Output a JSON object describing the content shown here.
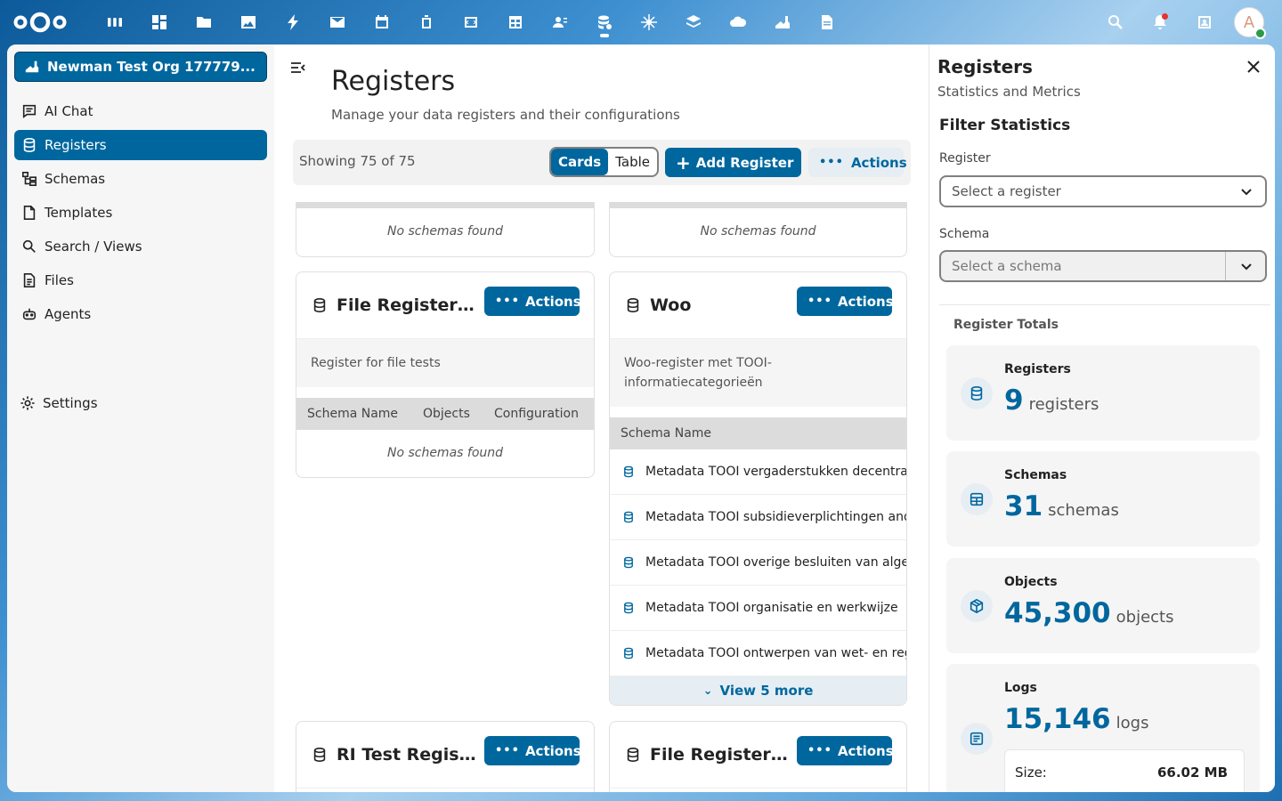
{
  "topbar": {
    "apps": [
      "apps-icon",
      "dashboard-icon",
      "files-icon",
      "photos-icon",
      "activity-icon",
      "mail-icon",
      "calendar-icon",
      "deck-icon",
      "code-icon",
      "spreadsheet-icon",
      "contacts-icon",
      "openregister-icon",
      "spider-icon",
      "layers-icon",
      "cloud-icon",
      "chart-icon",
      "document-icon"
    ],
    "active_app_index": 11,
    "avatar_initial": "A"
  },
  "sidebar": {
    "org_name": "Newman Test Org 177779...",
    "items": [
      {
        "label": "AI Chat",
        "icon": "chat-icon"
      },
      {
        "label": "Registers",
        "icon": "database-icon"
      },
      {
        "label": "Schemas",
        "icon": "schema-icon"
      },
      {
        "label": "Templates",
        "icon": "template-icon"
      },
      {
        "label": "Search / Views",
        "icon": "search-icon"
      },
      {
        "label": "Files",
        "icon": "file-icon"
      },
      {
        "label": "Agents",
        "icon": "robot-icon"
      }
    ],
    "settings_label": "Settings"
  },
  "main": {
    "title": "Registers",
    "subtitle": "Manage your data registers and their configurations",
    "showing": "Showing 75 of 75",
    "view_cards": "Cards",
    "view_table": "Table",
    "add_label": "Add Register",
    "actions_label": "Actions",
    "no_schemas": "No schemas found",
    "cards": [
      {
        "title": "File Register ...",
        "description": "Register for file tests",
        "columns": [
          "Schema Name",
          "Objects",
          "Configuration"
        ],
        "empty": "No schemas found"
      },
      {
        "title": "Woo",
        "description": "Woo-register met TOOI-informatiecategorieën",
        "columns": [
          "Schema Name"
        ],
        "rows": [
          "Metadata TOOI vergaderstukken decentrale",
          "Metadata TOOI subsidieverplichtingen ande",
          "Metadata TOOI overige besluiten van algem",
          "Metadata TOOI organisatie en werkwijze",
          "Metadata TOOI ontwerpen van wet- en rege"
        ],
        "view_more": "View 5 more"
      },
      {
        "title": "RI Test Regist..."
      },
      {
        "title": "File Register ..."
      }
    ]
  },
  "panel": {
    "title": "Registers",
    "subtitle": "Statistics and Metrics",
    "filter_title": "Filter Statistics",
    "register_label": "Register",
    "register_placeholder": "Select a register",
    "schema_label": "Schema",
    "schema_placeholder": "Select a schema",
    "totals_title": "Register Totals",
    "stats": [
      {
        "label": "Registers",
        "value": "9",
        "unit": "registers"
      },
      {
        "label": "Schemas",
        "value": "31",
        "unit": "schemas"
      },
      {
        "label": "Objects",
        "value": "45,300",
        "unit": "objects"
      },
      {
        "label": "Logs",
        "value": "15,146",
        "unit": "logs"
      }
    ],
    "size_label": "Size:",
    "size_value": "66.02 MB"
  },
  "colors": {
    "primary": "#00679e",
    "primary_light": "#e6eef4"
  }
}
